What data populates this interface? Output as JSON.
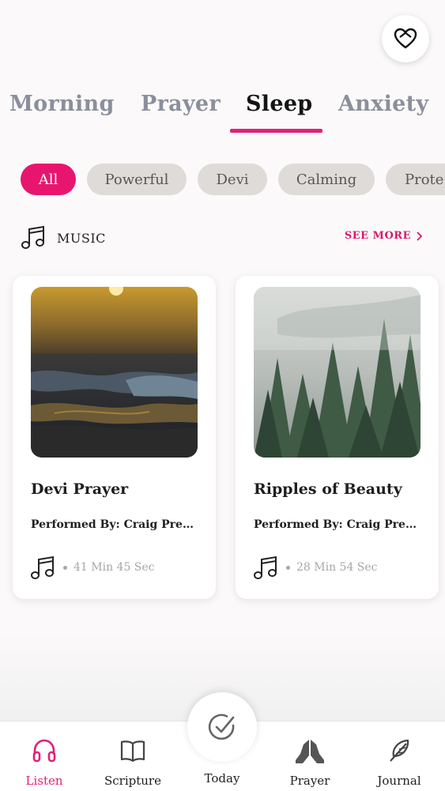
{
  "header": {
    "favorites_icon": "heart-icon"
  },
  "tabs": [
    {
      "label": "Morning",
      "active": false
    },
    {
      "label": "Prayer",
      "active": false
    },
    {
      "label": "Sleep",
      "active": true
    },
    {
      "label": "Anxiety",
      "active": false
    }
  ],
  "filters": [
    {
      "label": "All",
      "active": true
    },
    {
      "label": "Powerful",
      "active": false
    },
    {
      "label": "Devi",
      "active": false
    },
    {
      "label": "Calming",
      "active": false
    },
    {
      "label": "Prote",
      "active": false
    }
  ],
  "section": {
    "title": "MUSIC",
    "icon": "music-note-icon",
    "see_more": "SEE MORE"
  },
  "cards": [
    {
      "title": "Devi Prayer",
      "performer": "Performed By: Craig Preus...",
      "duration": "41 Min 45 Sec",
      "image": "ocean-sunset"
    },
    {
      "title": "Ripples of Beauty",
      "performer": "Performed By: Craig Preuss",
      "duration": "28 Min 54 Sec",
      "image": "misty-forest"
    }
  ],
  "nav": {
    "items": [
      {
        "label": "Listen",
        "icon": "headphones-icon",
        "active": true
      },
      {
        "label": "Scripture",
        "icon": "book-icon",
        "active": false
      },
      {
        "label": "Today",
        "icon": "check-circle-icon",
        "active": false
      },
      {
        "label": "Prayer",
        "icon": "praying-hands-icon",
        "active": false
      },
      {
        "label": "Journal",
        "icon": "feather-icon",
        "active": false
      }
    ]
  },
  "colors": {
    "accent": "#e0217a",
    "chip_inactive": "#dedbd8",
    "background": "#fbf9f9"
  }
}
